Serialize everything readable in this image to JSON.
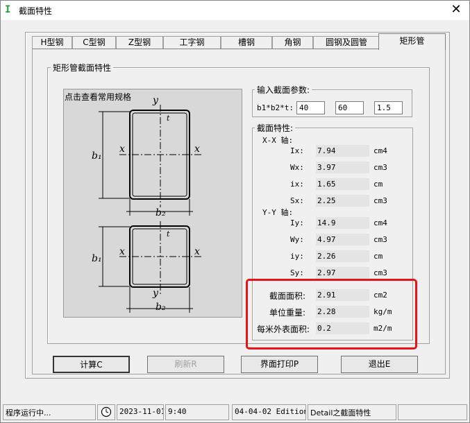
{
  "window": {
    "title": "截面特性"
  },
  "tabs": [
    {
      "label": "H型钢"
    },
    {
      "label": "C型钢"
    },
    {
      "label": "Z型钢"
    },
    {
      "label": "工字钢"
    },
    {
      "label": "槽钢"
    },
    {
      "label": "角钢"
    },
    {
      "label": "圆钢及圆管"
    },
    {
      "label": "矩形管"
    }
  ],
  "section_group": {
    "title": "矩形管截面特性"
  },
  "figure": {
    "label": "点击查看常用规格",
    "annotations": {
      "y": "y",
      "x": "x",
      "b1": "b₁",
      "b2": "b₂",
      "t": "t"
    }
  },
  "input_group": {
    "title": "输入截面参数:",
    "label": "b1*b2*t:",
    "b1": "40",
    "b2": "60",
    "t": "1.5"
  },
  "props_group": {
    "title": "截面特性:",
    "xx_axis": "X-X 轴:",
    "yy_axis": "Y-Y 轴:",
    "xx": [
      {
        "label": "Ix:",
        "value": "7.94",
        "unit": "cm4"
      },
      {
        "label": "Wx:",
        "value": "3.97",
        "unit": "cm3"
      },
      {
        "label": "ix:",
        "value": "1.65",
        "unit": "cm"
      },
      {
        "label": "Sx:",
        "value": "2.25",
        "unit": "cm3"
      }
    ],
    "yy": [
      {
        "label": "Iy:",
        "value": "14.9",
        "unit": "cm4"
      },
      {
        "label": "Wy:",
        "value": "4.97",
        "unit": "cm3"
      },
      {
        "label": "iy:",
        "value": "2.26",
        "unit": "cm"
      },
      {
        "label": "Sy:",
        "value": "2.97",
        "unit": "cm3"
      }
    ],
    "general": [
      {
        "label": "截面面积:",
        "value": "2.91",
        "unit": "cm2"
      },
      {
        "label": "单位重量:",
        "value": "2.28",
        "unit": "kg/m"
      },
      {
        "label": "每米外表面积:",
        "value": "0.2",
        "unit": "m2/m"
      }
    ]
  },
  "buttons": {
    "calc": "计算C",
    "refresh": "刷新R",
    "print": "界面打印P",
    "exit": "退出E"
  },
  "status": {
    "running": "程序运行中...",
    "date": "2023-11-01",
    "time": "9:40",
    "edition": "04-04-02 Edition",
    "detail": "Detail之截面特性"
  },
  "colors": {
    "highlight": "#e8121b",
    "figure_bg": "#d8d8d8"
  }
}
